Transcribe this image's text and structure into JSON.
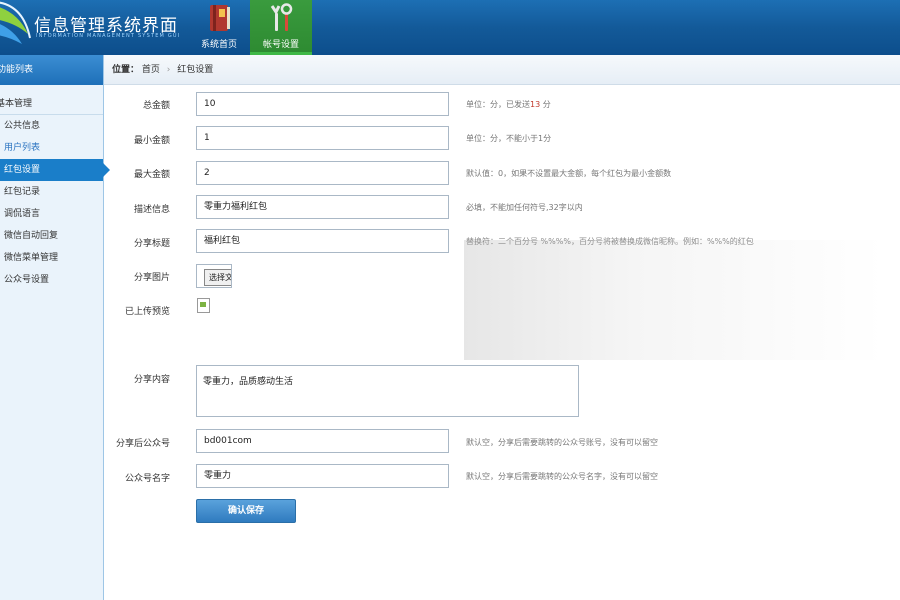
{
  "header": {
    "title": "信息管理系统界面",
    "subtitle": "INFORMATION MANAGEMENT SYSTEM GUI",
    "nav": [
      {
        "label": "系统首页",
        "icon": "book-icon"
      },
      {
        "label": "帐号设置",
        "icon": "tools-icon"
      }
    ]
  },
  "sidebar": {
    "title": "功能列表",
    "group": "基本管理",
    "items": [
      {
        "label": "公共信息"
      },
      {
        "label": "用户列表"
      },
      {
        "label": "红包设置"
      },
      {
        "label": "红包记录"
      },
      {
        "label": "调侃语言"
      },
      {
        "label": "微信自动回复"
      },
      {
        "label": "微信菜单管理"
      },
      {
        "label": "公众号设置"
      }
    ]
  },
  "breadcrumb": {
    "prefix": "位置：",
    "home": "首页",
    "separator": "›",
    "current": "红包设置"
  },
  "form": {
    "total": {
      "label": "总金额",
      "value": "10",
      "hint_a": "单位：分，已发送",
      "hint_num": "13",
      "hint_b": " 分"
    },
    "min": {
      "label": "最小金额",
      "value": "1",
      "hint": "单位：分，不能小于1分"
    },
    "max": {
      "label": "最大金额",
      "value": "2",
      "hint": "默认值：0，如果不设置最大金额，每个红包为最小金额数"
    },
    "desc": {
      "label": "描述信息",
      "value": "零重力福利红包",
      "hint": "必填，不能加任何符号,32字以内"
    },
    "share_title": {
      "label": "分享标题",
      "value": "福利红包",
      "hint": "替换符：二个百分号 %%%%，百分号将被替换成微信昵称。例如：%%%的红包"
    },
    "share_image": {
      "label": "分享图片",
      "button": "选择文件"
    },
    "preview": {
      "label": "已上传预览"
    },
    "share_content": {
      "label": "分享内容",
      "value": "零重力，品质感动生活"
    },
    "after_account": {
      "label": "分享后公众号",
      "value": "bd001com",
      "hint": "默认空，分享后需要跳转的公众号账号，没有可以留空"
    },
    "account_name": {
      "label": "公众号名字",
      "value": "零重力",
      "hint": "默认空，分享后需要跳转的公众号名字，没有可以留空"
    },
    "save": "确认保存"
  },
  "colors": {
    "header_blue": "#135a99",
    "active_green": "#2d8a31",
    "sidebar_active": "#1a7ec9",
    "highlight_red": "#c0392b"
  }
}
